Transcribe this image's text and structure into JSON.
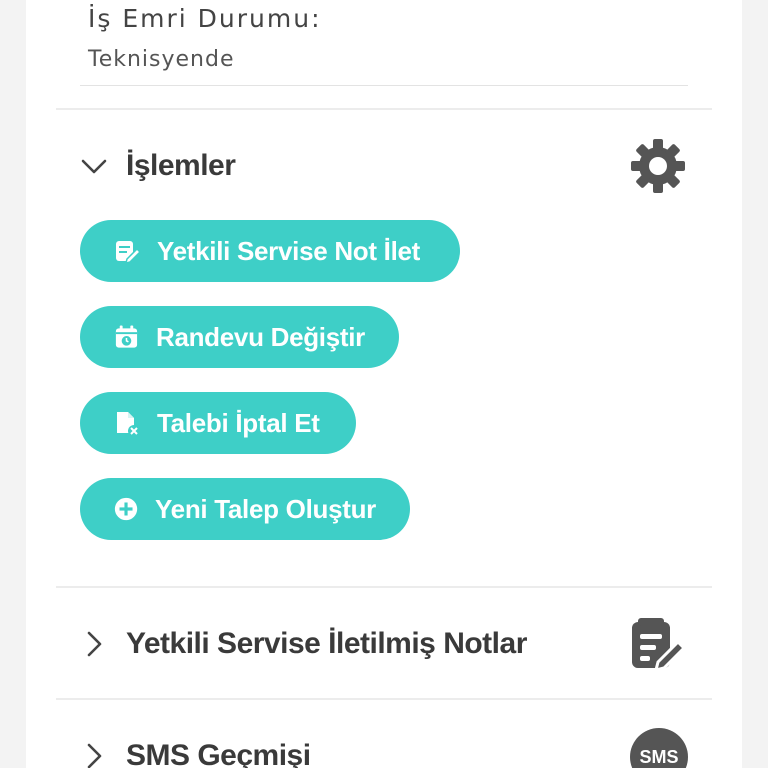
{
  "work_order": {
    "status_label": "İş Emri Durumu:",
    "status_value": "Teknisyende"
  },
  "sections": {
    "operations": {
      "title": "İşlemler",
      "icon": "gear-icon",
      "expanded": true
    },
    "notes": {
      "title": "Yetkili Servise İletilmiş Notlar",
      "icon": "notes-icon",
      "expanded": false
    },
    "sms": {
      "title": "SMS Geçmişi",
      "icon": "sms-icon",
      "icon_text": "SMS",
      "expanded": false
    }
  },
  "actions": [
    {
      "label": "Yetkili Servise Not İlet",
      "icon": "note-edit-icon"
    },
    {
      "label": "Randevu Değiştir",
      "icon": "calendar-clock-icon"
    },
    {
      "label": "Talebi İptal Et",
      "icon": "document-cancel-icon"
    },
    {
      "label": "Yeni Talep Oluştur",
      "icon": "plus-circle-icon"
    }
  ],
  "colors": {
    "accent": "#3ecfc7",
    "icon_gray": "#555555",
    "title_text": "#3a3a3a"
  }
}
